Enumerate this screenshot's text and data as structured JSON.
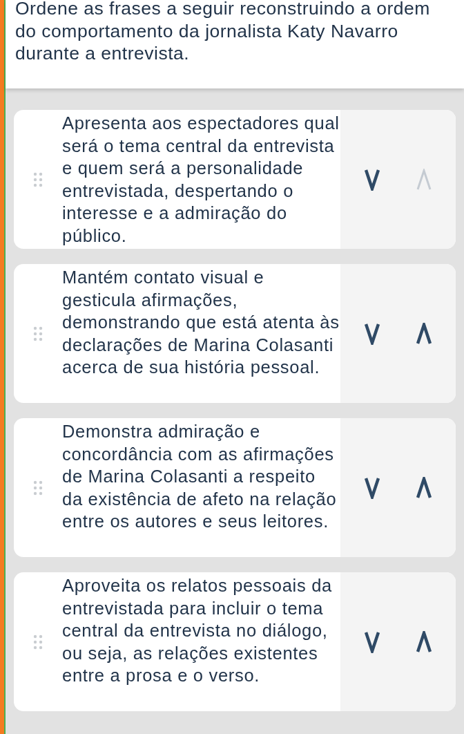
{
  "prompt": "Ordene as frases a seguir reconstruindo a ordem do comportamento da jornalista Katy Navarro durante a entrevista.",
  "items": [
    {
      "text": "Apresenta aos espectadores qual será o tema central da entrevista e quem será a personalidade entrevistada, despertando o interesse e a admiração do público.",
      "down_disabled": false,
      "up_disabled": true
    },
    {
      "text": "Mantém contato visual e gesticula afirmações, demonstrando que está atenta às declarações de Marina Colasanti acerca de sua história pessoal.",
      "down_disabled": false,
      "up_disabled": false
    },
    {
      "text": "Demonstra admiração e concordância com as afirmações de Marina Colasanti a respeito da existência de afeto na relação entre os autores e seus leitores.",
      "down_disabled": false,
      "up_disabled": false
    },
    {
      "text": "Aproveita os relatos pessoais da entrevistada para incluir o tema central da entrevista no diálogo, ou seja, as relações existentes entre a prosa e o verso.",
      "down_disabled": false,
      "up_disabled": false
    }
  ]
}
